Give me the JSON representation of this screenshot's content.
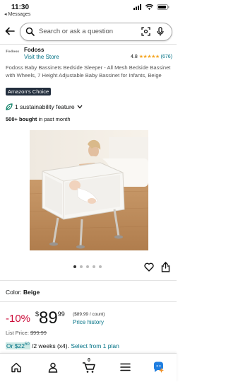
{
  "status_bar": {
    "time": "11:30",
    "back_label": "◂ Messages"
  },
  "search": {
    "placeholder": "Search or ask a question"
  },
  "brand": {
    "logo_text": "Fodoss",
    "name": "Fodoss",
    "visit_store": "Visit the Store"
  },
  "rating": {
    "value": "4.8",
    "stars": "★★★★★",
    "count": "(676)"
  },
  "product": {
    "title": "Fodoss Baby Bassinets Bedside Sleeper - All Mesh Bedside Bassinet with Wheels, 7 Height Adjustable Baby Bassinet for Infants, Beige",
    "badge": "Amazon's Choice",
    "sustainability": "1 sustainability feature",
    "bought_bold": "500+ bought",
    "bought_rest": " in past month"
  },
  "gallery": {
    "total": 5,
    "active_index": 0
  },
  "color": {
    "label": "Color: ",
    "value": "Beige"
  },
  "pricing": {
    "discount": "-10%",
    "currency": "$",
    "whole": "89",
    "fraction": "99",
    "unit_price": "($89.99 / count)",
    "history_link": "Price history",
    "list_price_label": "List Price: ",
    "list_price": "$99.99",
    "plan_prefix": "Or $22",
    "plan_cents": "50",
    "plan_mid": " /2 weeks (x4). ",
    "plan_link": "Select from 1 plan"
  },
  "bottom_nav": {
    "cart_count": "0"
  },
  "colors": {
    "link": "#007185",
    "deal_red": "#cc0c39",
    "badge_bg": "#232f3e",
    "star": "#f5a623",
    "ai_blue": "#1f7ee0",
    "ai_orange": "#f0932b"
  }
}
